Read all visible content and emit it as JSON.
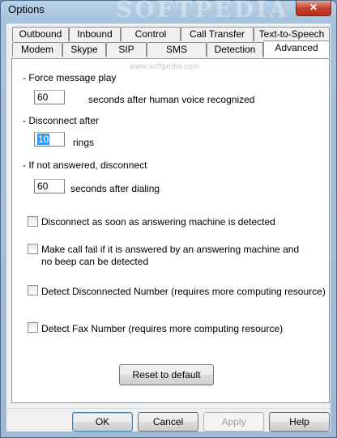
{
  "window": {
    "title": "Options",
    "close_glyph": "✕",
    "watermark": "SOFTPEDIA"
  },
  "tabs": {
    "row_back": [
      "Outbound",
      "Inbound",
      "Control",
      "Call Transfer",
      "Text-to-Speech"
    ],
    "row_front": [
      "Modem",
      "Skype",
      "SIP",
      "SMS",
      "Detection",
      "Advanced"
    ],
    "active": "Advanced"
  },
  "panel": {
    "watermark": "www.softpedia.com",
    "force_message": {
      "heading": "- Force message play",
      "value": "60",
      "suffix": "seconds after human voice recognized"
    },
    "disconnect_after": {
      "heading": "- Disconnect after",
      "value": "10",
      "suffix": "rings"
    },
    "not_answered": {
      "heading": "- If not answered, disconnect",
      "value": "60",
      "suffix": "seconds after dialing"
    },
    "checkboxes": [
      {
        "label": "Disconnect as soon as answering machine is detected",
        "checked": false
      },
      {
        "label": "Make call fail if it is answered by an answering machine and no beep can be detected",
        "checked": false
      },
      {
        "label": "Detect Disconnected Number (requires more computing resource)",
        "checked": false
      },
      {
        "label": "Detect Fax Number (requires more computing resource)",
        "checked": false
      }
    ],
    "reset_label": "Reset to default"
  },
  "buttons": {
    "ok": "OK",
    "cancel": "Cancel",
    "apply": "Apply",
    "help": "Help"
  }
}
